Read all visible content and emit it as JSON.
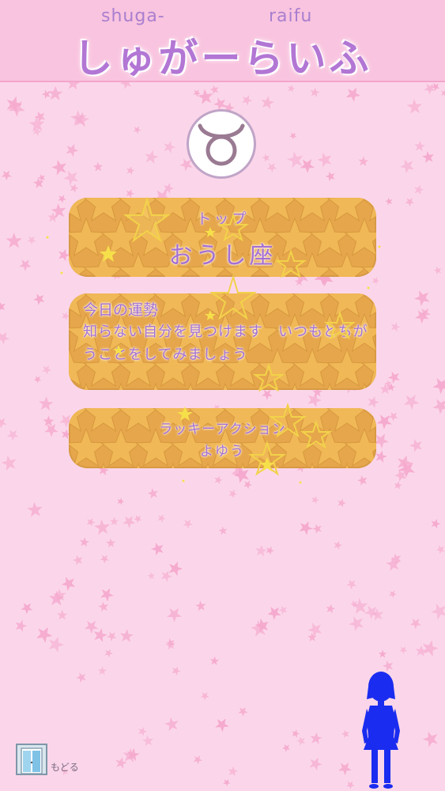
{
  "header": {
    "romaji_left": "shuga-",
    "romaji_right": "raifu",
    "title": "しゅがーらいふ"
  },
  "sign": {
    "icon": "taurus-icon",
    "top_label": "トップ",
    "name": "おうし座"
  },
  "fortune": {
    "title": "今日の運勢",
    "text": "知らない自分を見つけます　いつもとちがうことをしてみましょう"
  },
  "lucky": {
    "title": "ラッキーアクション",
    "value": "よゆう"
  },
  "footer": {
    "back_label": "もどる"
  },
  "colors": {
    "background": "#fbd6ea",
    "header": "#f9c4df",
    "panel": "#e6a64b",
    "text": "#a56fd3",
    "title": "#b276d4",
    "avatar": "#1a2cf0"
  }
}
